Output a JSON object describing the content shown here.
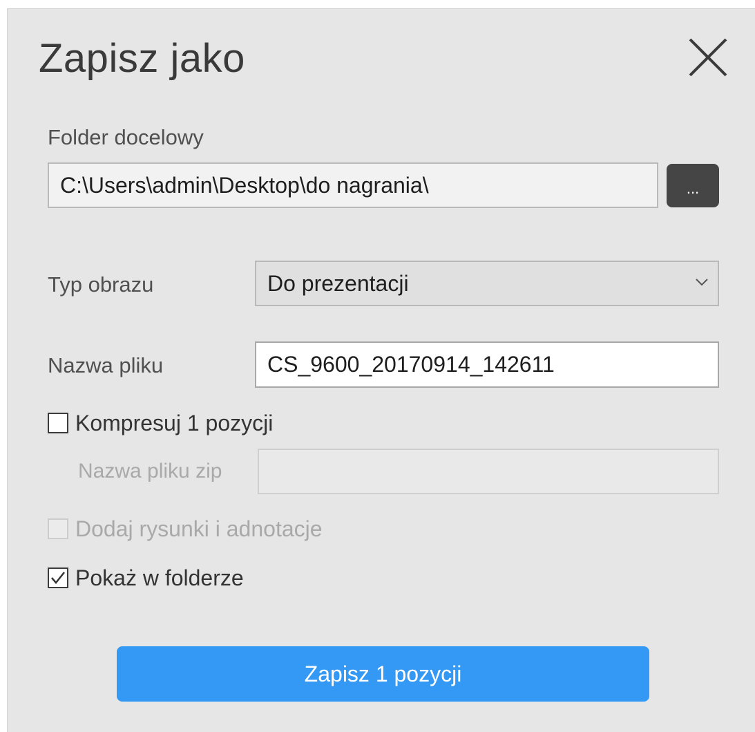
{
  "dialog": {
    "title": "Zapisz jako",
    "close_icon": "close-icon"
  },
  "destination": {
    "label": "Folder docelowy",
    "value": "C:\\Users\\admin\\Desktop\\do nagrania\\",
    "browse_label": "..."
  },
  "image_type": {
    "label": "Typ obrazu",
    "selected": "Do prezentacji",
    "icon": "chevron-down-icon"
  },
  "file_name": {
    "label": "Nazwa pliku",
    "value": "CS_9600_20170914_142611"
  },
  "compress": {
    "label": "Kompresuj 1 pozycji",
    "checked": false
  },
  "zip_name": {
    "label": "Nazwa pliku zip",
    "value": ""
  },
  "annotations": {
    "label": "Dodaj rysunki i adnotacje",
    "checked": false,
    "enabled": false
  },
  "show_in_folder": {
    "label": "Pokaż w folderze",
    "checked": true
  },
  "save_button": {
    "label": "Zapisz 1 pozycji",
    "color": "#3399f5"
  }
}
